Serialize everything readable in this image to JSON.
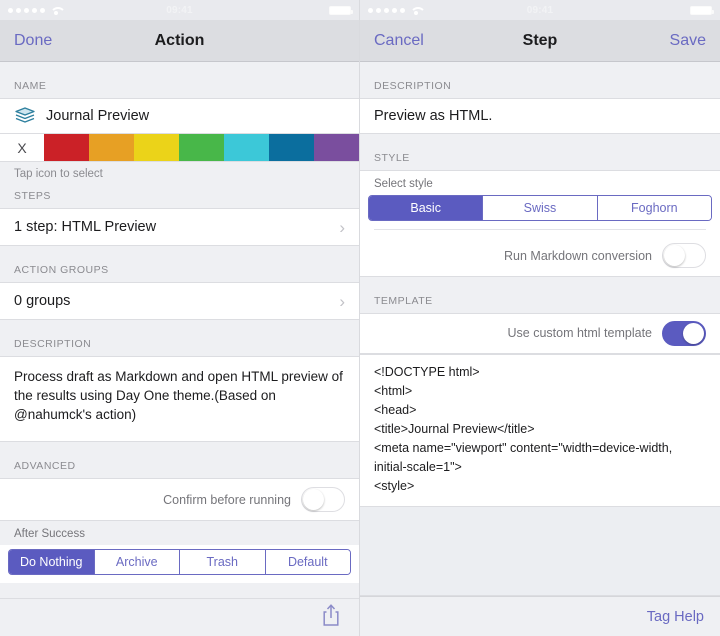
{
  "left": {
    "statusbar": {
      "time": "09:41",
      "signal_dots": 5,
      "wifi": "wifi-icon",
      "battery": "battery-icon"
    },
    "nav": {
      "left_button": "Done",
      "title": "Action"
    },
    "name_section": {
      "header": "NAME",
      "icon": "layers-stack-icon",
      "value": "Journal Preview"
    },
    "color_picker": {
      "clear_label": "X",
      "swatches": [
        "#cb2127",
        "#e7a024",
        "#ebd319",
        "#48b749",
        "#3cc8d8",
        "#0b6e9e",
        "#7a4e9e"
      ],
      "hint": "Tap icon to select"
    },
    "steps_section": {
      "header": "STEPS",
      "value": "1 step: HTML Preview",
      "chevron": "chevron-right-icon"
    },
    "groups_section": {
      "header": "ACTION GROUPS",
      "value": "0 groups",
      "chevron": "chevron-right-icon"
    },
    "description_section": {
      "header": "DESCRIPTION",
      "text": "Process draft as Markdown and open HTML preview of the results using Day One theme.(Based on @nahumck's action)"
    },
    "advanced_section": {
      "header": "ADVANCED",
      "confirm_label": "Confirm before running",
      "confirm_on": false,
      "after_success_label": "After Success",
      "after_success_options": [
        "Do Nothing",
        "Archive",
        "Trash",
        "Default"
      ],
      "after_success_selected": "Do Nothing"
    },
    "toolbar": {
      "share": "share-icon"
    }
  },
  "right": {
    "statusbar": {
      "time": "09:41",
      "signal_dots": 5,
      "wifi": "wifi-icon",
      "battery": "battery-icon"
    },
    "nav": {
      "left_button": "Cancel",
      "title": "Step",
      "right_button": "Save"
    },
    "description_section": {
      "header": "DESCRIPTION",
      "text": "Preview as HTML."
    },
    "style_section": {
      "header": "STYLE",
      "select_label": "Select style",
      "options": [
        "Basic",
        "Swiss",
        "Foghorn"
      ],
      "selected": "Basic",
      "markdown_label": "Run Markdown conversion",
      "markdown_on": false
    },
    "template_section": {
      "header": "TEMPLATE",
      "custom_label": "Use custom html template",
      "custom_on": true,
      "code": "<!DOCTYPE html>\n<html>\n<head>\n<title>Journal Preview</title>\n<meta name=\"viewport\" content=\"width=device-width, initial-scale=1\">\n<style>"
    },
    "bottom": {
      "tag_help": "Tag Help"
    }
  },
  "theme": {
    "accent": "#5b5bc0",
    "accent_text": "#6a6ac2",
    "nav_bg": "#dcdde1",
    "group_bg": "#eff0f3"
  }
}
